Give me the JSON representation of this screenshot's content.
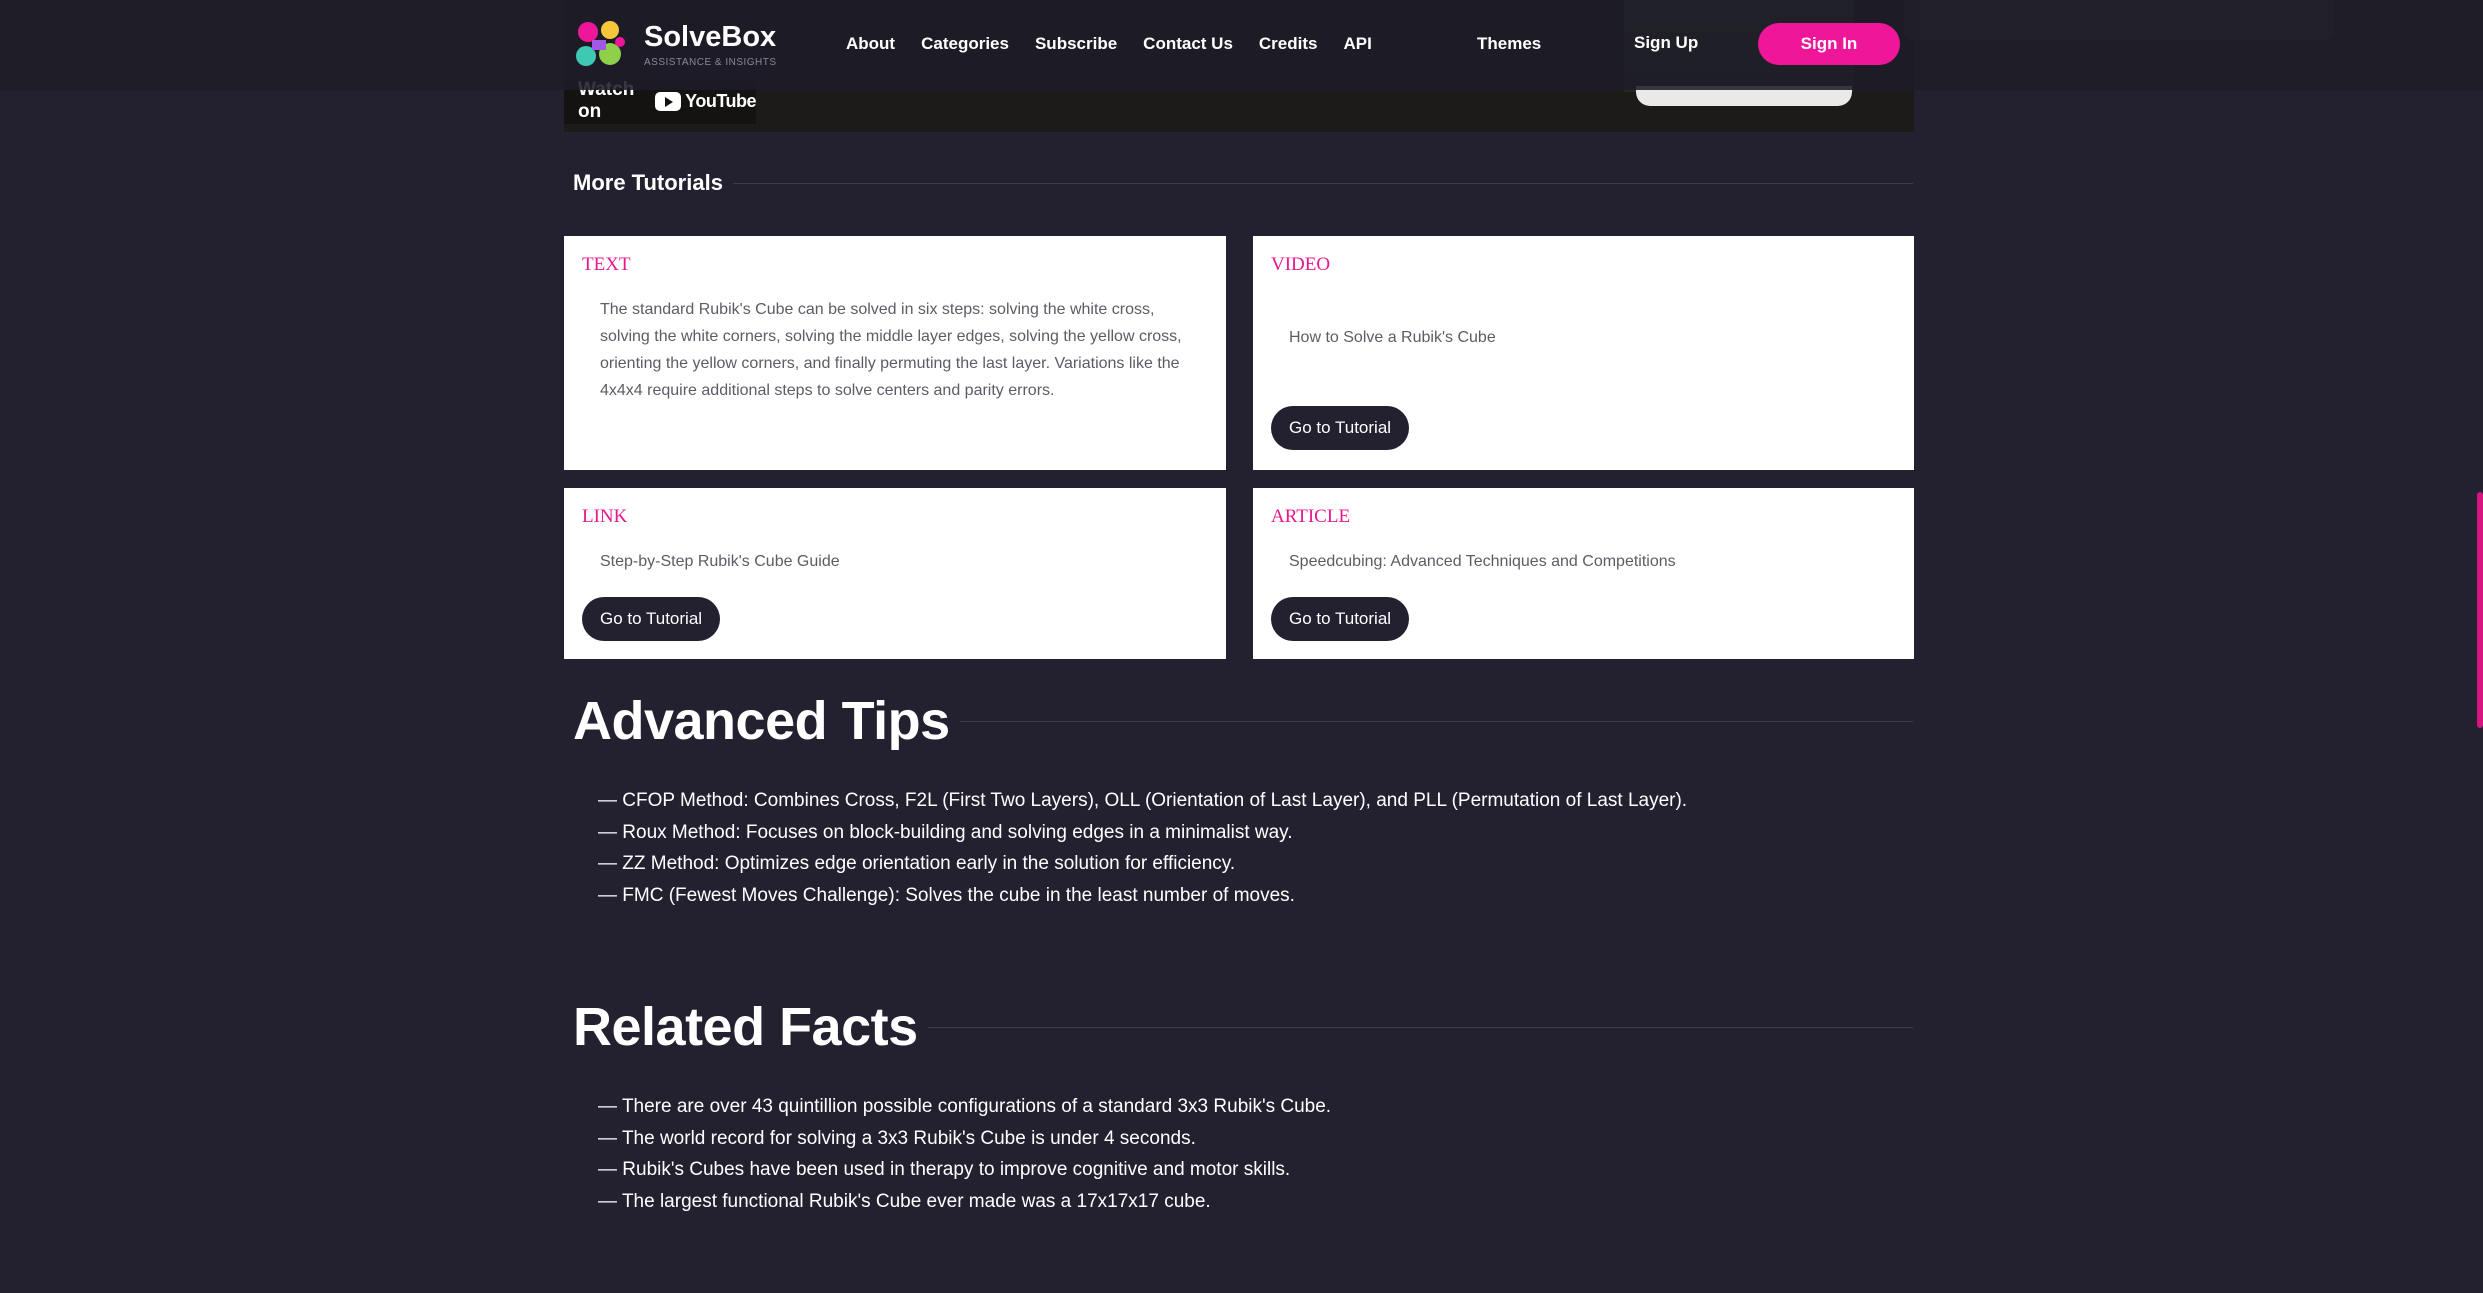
{
  "header": {
    "brand_name": "SolveBox",
    "brand_tagline": "ASSISTANCE & INSIGHTS",
    "nav": [
      "About",
      "Categories",
      "Subscribe",
      "Contact Us",
      "Credits",
      "API"
    ],
    "themes": "Themes",
    "sign_up": "Sign Up",
    "sign_in": "Sign In"
  },
  "video": {
    "watch_on": "Watch on",
    "platform": "YouTube"
  },
  "more_tutorials": {
    "title": "More Tutorials",
    "cards": [
      {
        "type": "TEXT",
        "text": "The standard Rubik's Cube can be solved in six steps: solving the white cross, solving the white corners, solving the middle layer edges, solving the yellow cross, orienting the yellow corners, and finally permuting the last layer. Variations like the 4x4x4 require additional steps to solve centers and parity errors."
      },
      {
        "type": "VIDEO",
        "text": "How to Solve a Rubik's Cube",
        "button": "Go to Tutorial"
      },
      {
        "type": "LINK",
        "text": "Step-by-Step Rubik's Cube Guide",
        "button": "Go to Tutorial"
      },
      {
        "type": "ARTICLE",
        "text": "Speedcubing: Advanced Techniques and Competitions",
        "button": "Go to Tutorial"
      }
    ]
  },
  "advanced_tips": {
    "title": "Advanced Tips",
    "items": [
      "CFOP Method: Combines Cross, F2L (First Two Layers), OLL (Orientation of Last Layer), and PLL (Permutation of Last Layer).",
      "Roux Method: Focuses on block-building and solving edges in a minimalist way.",
      "ZZ Method: Optimizes edge orientation early in the solution for efficiency.",
      "FMC (Fewest Moves Challenge): Solves the cube in the least number of moves."
    ]
  },
  "related_facts": {
    "title": "Related Facts",
    "items": [
      "There are over 43 quintillion possible configurations of a standard 3x3 Rubik's Cube.",
      "The world record for solving a 3x3 Rubik's Cube is under 4 seconds.",
      "Rubik's Cubes have been used in therapy to improve cognitive and motor skills.",
      "The largest functional Rubik's Cube ever made was a 17x17x17 cube."
    ]
  },
  "colors": {
    "background": "#23212f",
    "accent": "#f0169a",
    "card": "#ffffff",
    "button": "#23212f"
  }
}
